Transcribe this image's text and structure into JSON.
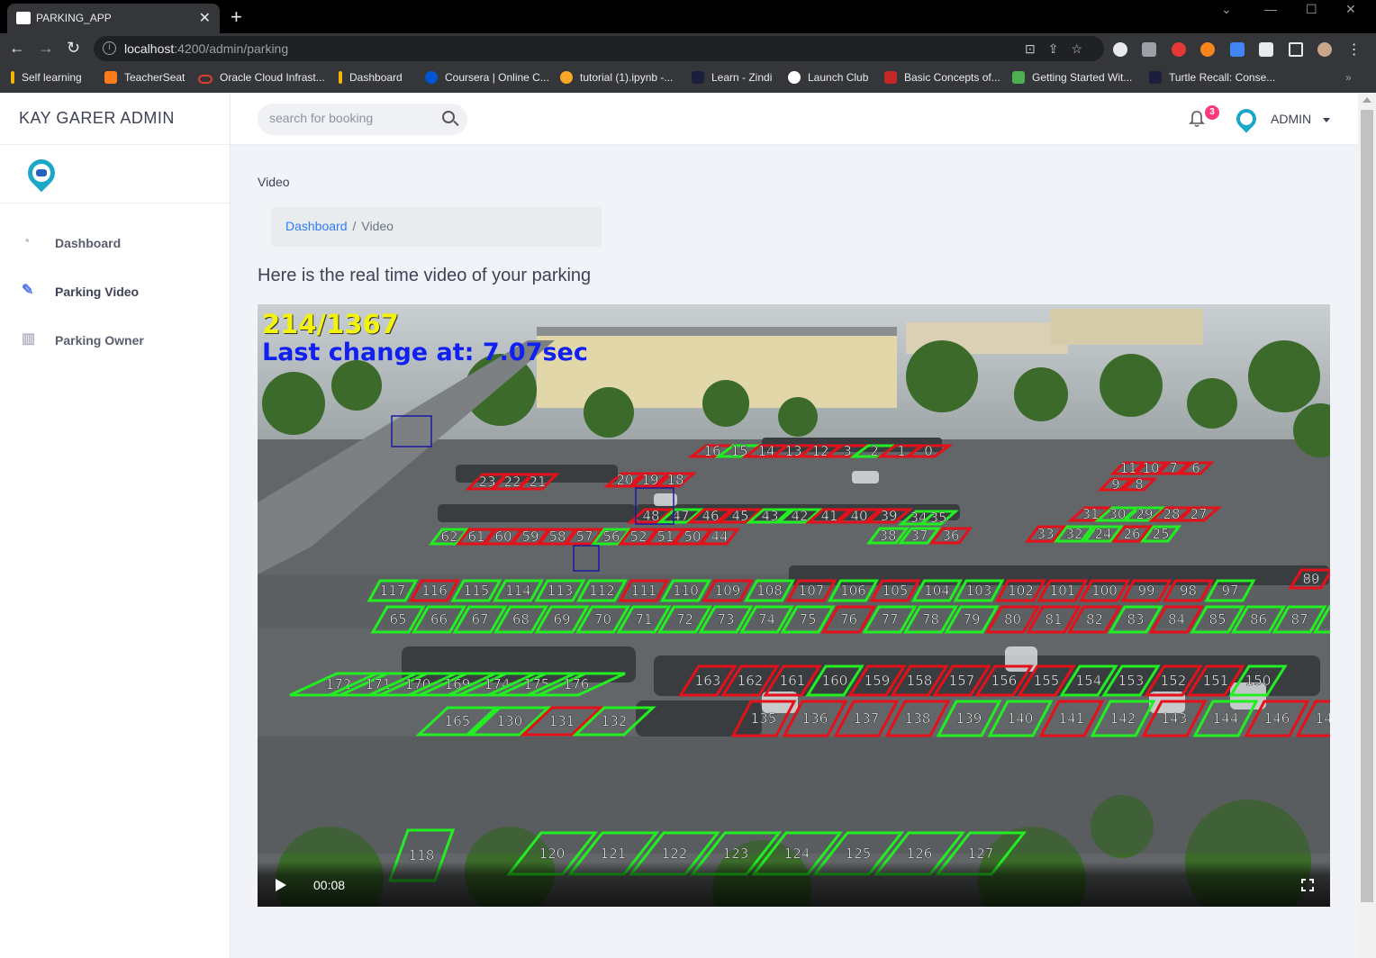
{
  "browser": {
    "tab_title": "PARKING_APP",
    "tab_close": "✕",
    "new_tab": "+",
    "url_host": "localhost",
    "url_path": ":4200/admin/parking",
    "bookmarks": [
      {
        "label": "Self learning",
        "color": "#f4b400"
      },
      {
        "label": "TeacherSeat",
        "color": "#ff7a1a"
      },
      {
        "label": "Oracle Cloud Infrast...",
        "color": "#e03c31"
      },
      {
        "label": "Dashboard",
        "color": "#f4b400"
      },
      {
        "label": "Coursera | Online C...",
        "color": "#0056d2"
      },
      {
        "label": "tutorial (1).ipynb -...",
        "color": "#f9a825"
      },
      {
        "label": "Learn - Zindi",
        "color": "#1b1f3b"
      },
      {
        "label": "Launch Club",
        "color": "#ffffff"
      },
      {
        "label": "Basic Concepts of...",
        "color": "#c62828"
      },
      {
        "label": "Getting Started Wit...",
        "color": "#4caf50"
      },
      {
        "label": "Turtle Recall: Conse...",
        "color": "#1b1f3b"
      }
    ]
  },
  "sidebar": {
    "brand": "KAY GARER ADMIN",
    "items": [
      {
        "label": "Dashboard",
        "icon": "dashboard-icon",
        "glyph": "◔",
        "active": false
      },
      {
        "label": "Parking Video",
        "icon": "edit-icon",
        "glyph": "✎",
        "active": true
      },
      {
        "label": "Parking Owner",
        "icon": "map-icon",
        "glyph": "▥",
        "active": false
      }
    ]
  },
  "topbar": {
    "search_placeholder": "search for booking",
    "notification_count": "3",
    "user_name": "ADMIN"
  },
  "page": {
    "subheader": "Video",
    "breadcrumb": {
      "home": "Dashboard",
      "separator": "/",
      "current": "Video"
    },
    "heading": "Here is the real time video of your parking"
  },
  "video": {
    "count_overlay": "214/1367",
    "change_overlay": "Last change at: 7.07sec",
    "current_time": "00:08",
    "colors": {
      "free": "#22ee22",
      "occupied": "#e4101a"
    }
  }
}
